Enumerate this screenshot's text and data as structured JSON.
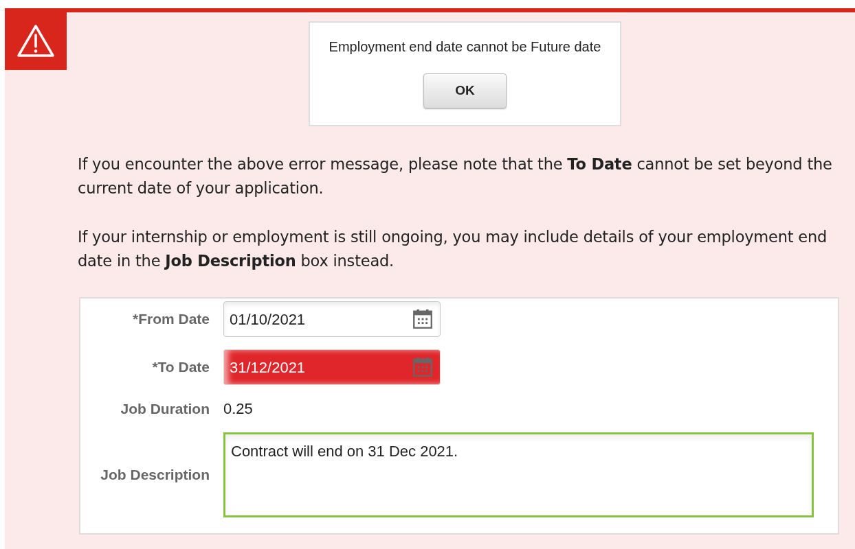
{
  "dialog": {
    "message": "Employment end date cannot be Future date",
    "button": "OK"
  },
  "paragraphs": [
    "If you encounter the above error message, please note that the **To Date** cannot be set beyond the current date of your application.",
    "If your internship or employment is still ongoing, you may include details of your employment end date in the **Job Description** box instead."
  ],
  "form": {
    "fields": [
      {
        "kind": "date",
        "label": "*From Date",
        "value": "01/10/2021",
        "invalid": false
      },
      {
        "kind": "date",
        "label": "*To Date",
        "value": "31/12/2021",
        "invalid": true
      },
      {
        "kind": "text",
        "label": "Job Duration",
        "value": "0.25"
      },
      {
        "kind": "textarea",
        "label": "Job Description",
        "value": "Contract will end on 31 Dec 2021."
      }
    ]
  }
}
